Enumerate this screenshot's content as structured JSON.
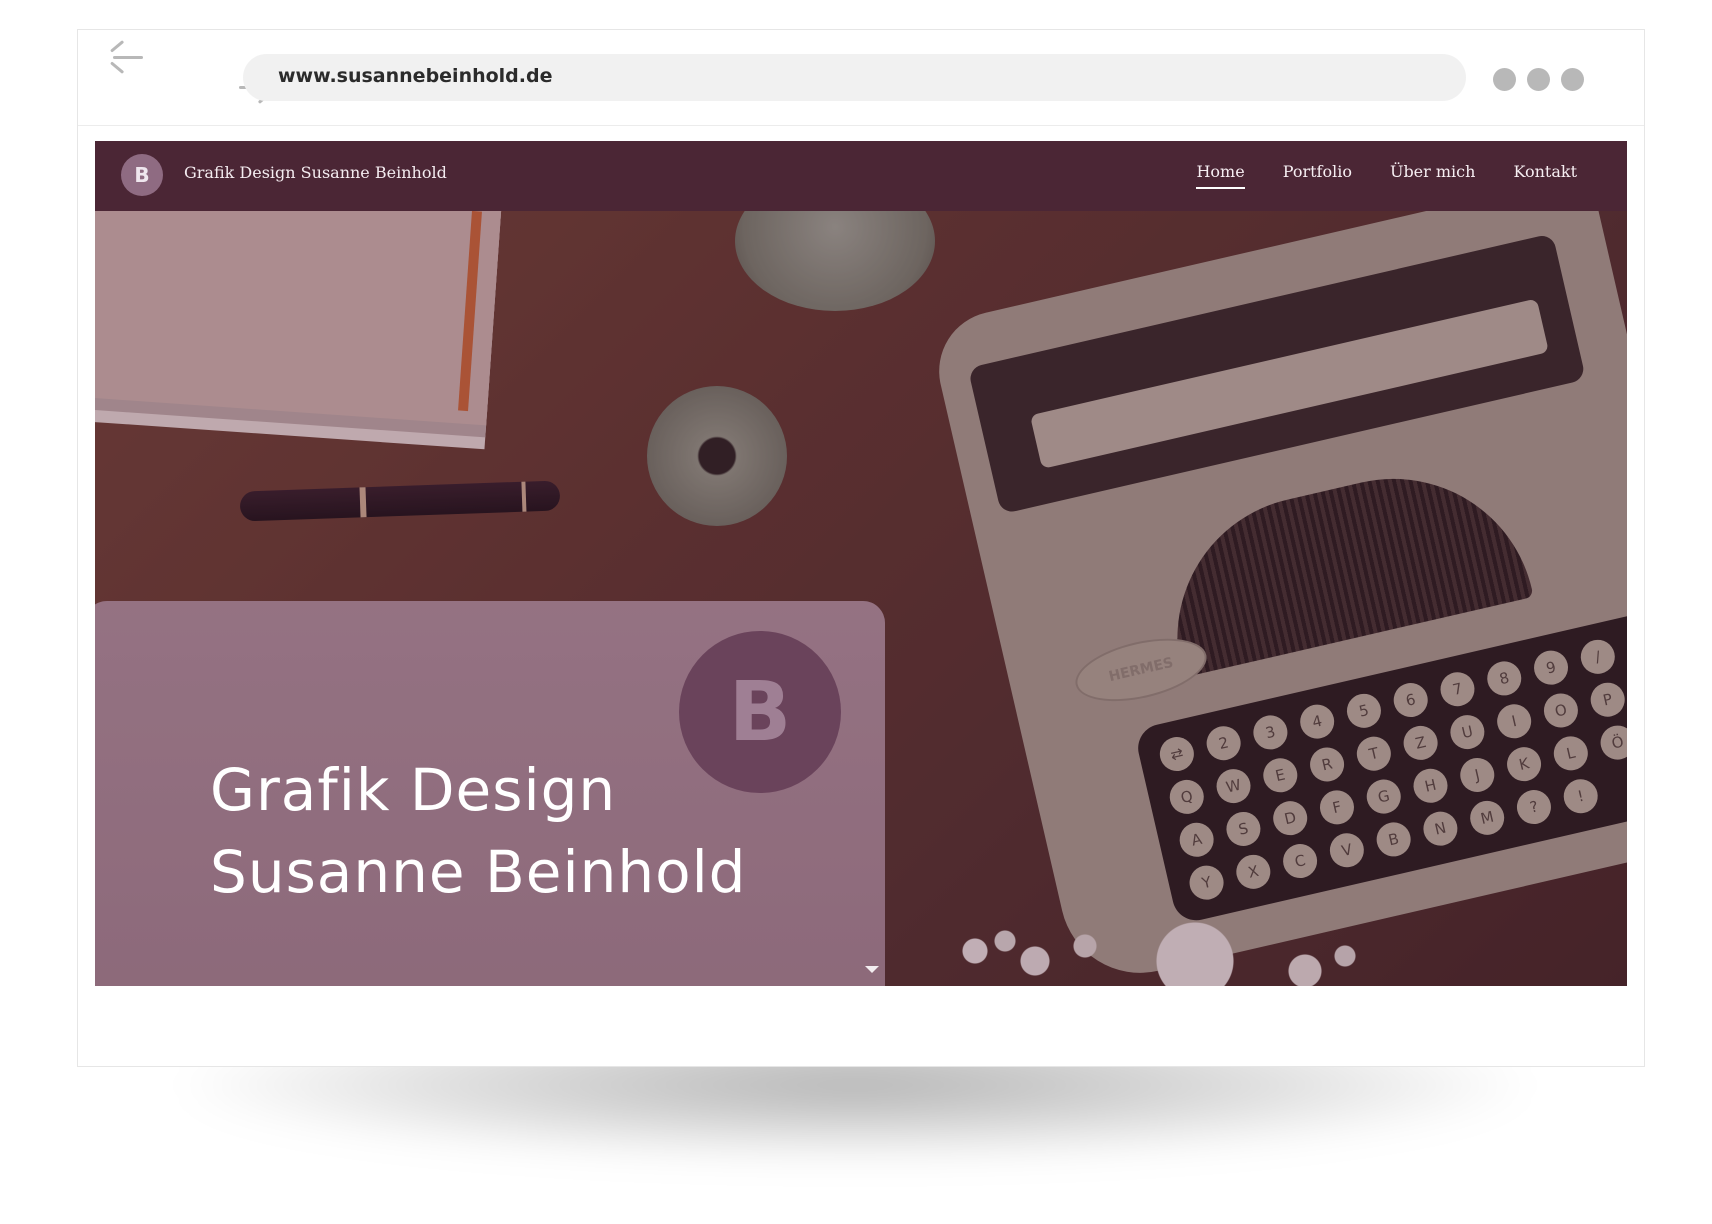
{
  "browser": {
    "url": "www.susannebeinhold.de",
    "back_icon": "arrow-left-icon",
    "forward_icon": "arrow-right-icon",
    "menu_dots_icon": "three-dots-icon"
  },
  "site": {
    "logo_letter": "B",
    "title": "Grafik Design Susanne Beinhold",
    "nav": [
      {
        "label": "Home",
        "active": true
      },
      {
        "label": "Portfolio",
        "active": false
      },
      {
        "label": "Über mich",
        "active": false
      },
      {
        "label": "Kontakt",
        "active": false
      }
    ],
    "colors": {
      "header_bg": "#4b2635",
      "accent": "#6e4c62"
    }
  },
  "hero": {
    "heading_line1": "Grafik Design",
    "heading_line2": "Susanne Beinhold",
    "badge_letter": "B",
    "typewriter_brand": "HERMES",
    "keys_row1": [
      "⇄",
      "2",
      "3",
      "4",
      "5",
      "6",
      "7",
      "8",
      "9",
      "/"
    ],
    "keys_row2": [
      "Q",
      "W",
      "E",
      "R",
      "T",
      "Z",
      "U",
      "I",
      "O",
      "P"
    ],
    "keys_row3": [
      "A",
      "S",
      "D",
      "F",
      "G",
      "H",
      "J",
      "K",
      "L",
      "Ö"
    ],
    "keys_row4": [
      "Y",
      "X",
      "C",
      "V",
      "B",
      "N",
      "M",
      "?",
      "!"
    ],
    "scroll_icon": "caret-down-icon"
  }
}
